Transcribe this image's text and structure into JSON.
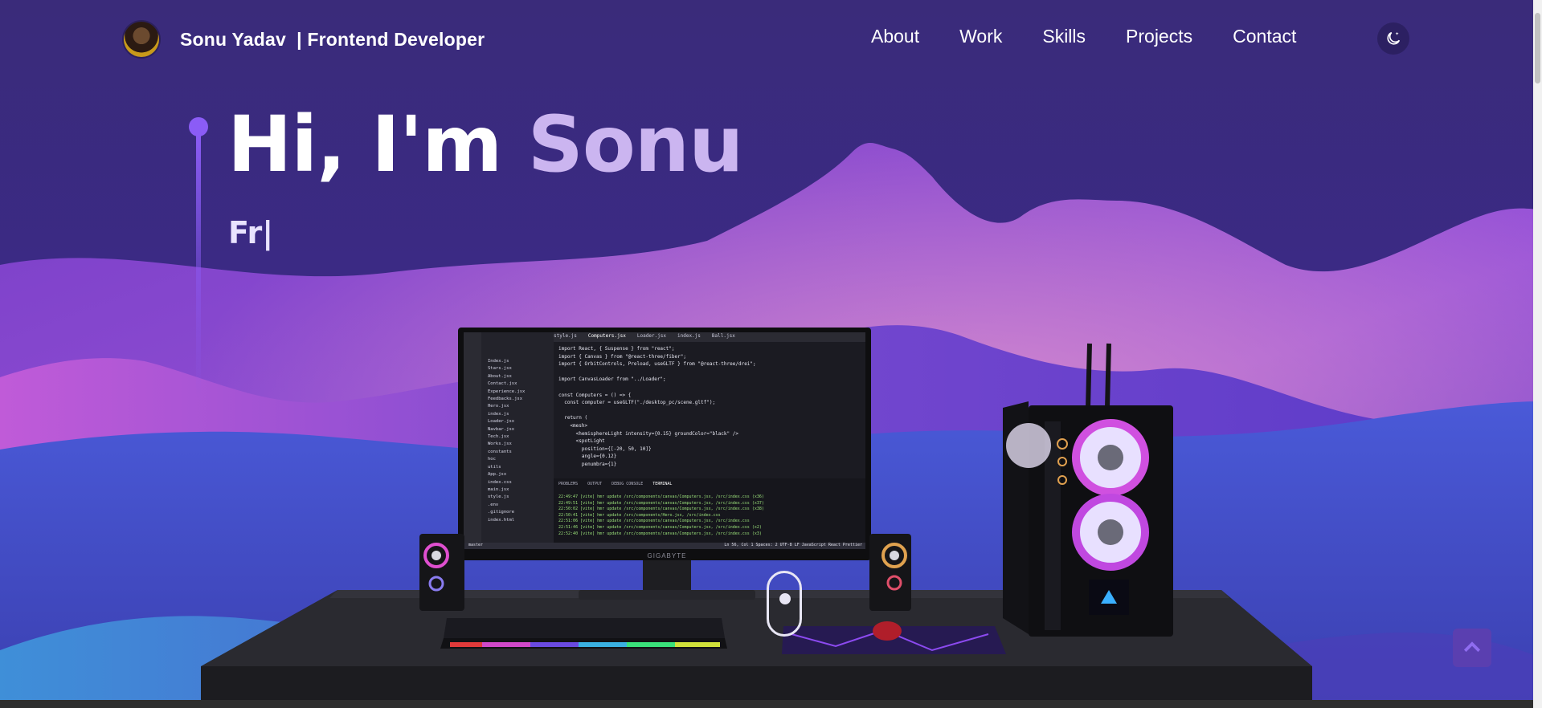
{
  "header": {
    "brand": "Sonu Yadav  | Frontend Developer",
    "nav": [
      {
        "label": "About"
      },
      {
        "label": "Work"
      },
      {
        "label": "Skills"
      },
      {
        "label": "Projects"
      },
      {
        "label": "Contact"
      }
    ],
    "theme_icon": "moon-icon"
  },
  "hero": {
    "greeting": "Hi, I'm ",
    "name": "Sonu",
    "typed": "Fr|"
  },
  "computer": {
    "monitor_brand": "GIGABYTE",
    "editor_tabs": [
      "style.js",
      "Computers.jsx",
      "Loader.jsx",
      "index.js",
      "Ball.jsx"
    ],
    "code_lines": [
      "import React, { Suspense } from \"react\";",
      "import { Canvas } from \"@react-three/fiber\";",
      "import { OrbitControls, Preload, useGLTF } from \"@react-three/drei\";",
      "",
      "import CanvasLoader from \"../Loader\";",
      "",
      "const Computers = () => {",
      "  const computer = useGLTF(\"./desktop_pc/scene.gltf\");",
      "",
      "  return (",
      "    <mesh>",
      "      <hemisphereLight intensity={0.15} groundColor=\"black\" />",
      "      <spotLight",
      "        position={[-20, 50, 10]}",
      "        angle={0.12}",
      "        penumbra={1}"
    ],
    "file_tree": [
      "Index.js",
      "Stars.jsx",
      "About.jsx",
      "Contact.jsx",
      "Experience.jsx",
      "Feedbacks.jsx",
      "Hero.jsx",
      "index.js",
      "Loader.jsx",
      "Navbar.jsx",
      "Tech.jsx",
      "Works.jsx",
      "constants",
      "hoc",
      "utils",
      "App.jsx",
      "index.css",
      "main.jsx",
      "style.js",
      ".env",
      ".gitignore",
      "index.html"
    ],
    "terminal_tabs": [
      "PROBLEMS",
      "OUTPUT",
      "DEBUG CONSOLE",
      "TERMINAL"
    ],
    "terminal_lines": [
      "22:49:47 [vite] hmr update /src/components/canvas/Computers.jsx, /src/index.css (x36)",
      "22:49:51 [vite] hmr update /src/components/canvas/Computers.jsx, /src/index.css (x37)",
      "22:50:02 [vite] hmr update /src/components/canvas/Computers.jsx, /src/index.css (x38)",
      "22:50:41 [vite] hmr update /src/components/Hero.jsx, /src/index.css",
      "22:51:06 [vite] hmr update /src/components/canvas/Computers.jsx, /src/index.css",
      "22:51:46 [vite] hmr update /src/components/canvas/Computers.jsx, /src/index.css (x2)",
      "22:52:40 [vite] hmr update /src/components/canvas/Computers.jsx, /src/index.css (x3)"
    ],
    "status_left": "master",
    "status_right": "Ln 56, Col 1  Spaces: 2  UTF-8  LF  JavaScript React  Prettier"
  },
  "colors": {
    "accent": "#8b5cf6",
    "name_color": "#cbb5f0",
    "bg_top": "#3a2b7a"
  }
}
